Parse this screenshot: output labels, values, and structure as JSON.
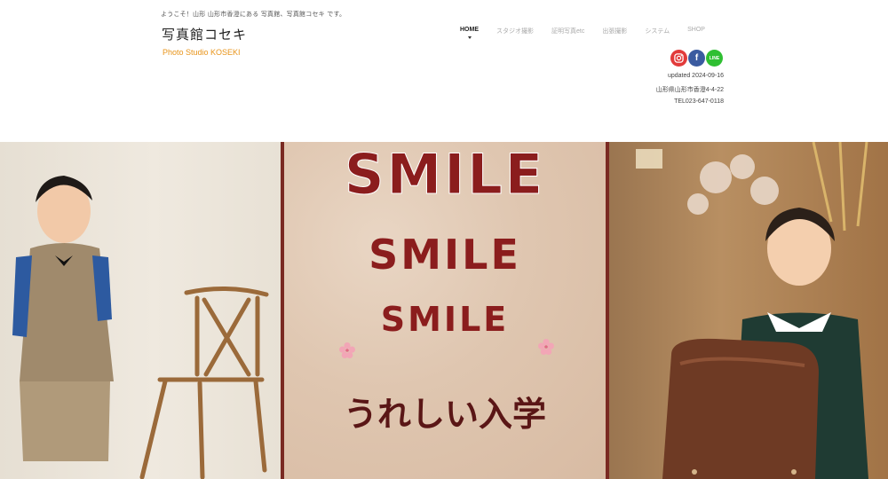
{
  "header": {
    "tagline": "ようこそ！山形 山形市香澄にある 写真館、写真館コセキ です。",
    "logo_jp": "写真館コセキ",
    "logo_en": "Photo Studio KOSEKI"
  },
  "nav": {
    "items": [
      {
        "label": "HOME",
        "active": true
      },
      {
        "label": "スタジオ撮影"
      },
      {
        "label": "証明写真etc"
      },
      {
        "label": "出張撮影"
      },
      {
        "label": "システム"
      },
      {
        "label": "SHOP"
      }
    ]
  },
  "social": {
    "instagram_icon": "instagram-icon",
    "facebook_icon": "facebook-icon",
    "line_icon": "line-icon",
    "facebook_glyph": "f",
    "line_glyph": "LINE"
  },
  "info": {
    "updated": "updated 2024-09-16",
    "address": "山形県山形市香澄4-4-22",
    "tel": "TEL023-647-0118"
  },
  "hero": {
    "smile_1": "SMILE",
    "smile_2": "SMILE",
    "smile_3": "SMILE",
    "title": "うれしい入学"
  },
  "colors": {
    "accent": "#e8941a",
    "banner_red": "#8b1d1d"
  }
}
